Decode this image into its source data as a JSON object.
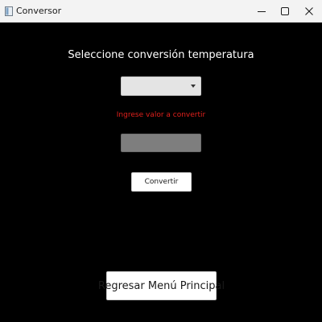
{
  "window": {
    "title": "Conversor",
    "app_icon": "window-app-icon",
    "controls": {
      "minimize_icon": "minimize-icon",
      "maximize_icon": "maximize-icon",
      "close_icon": "close-icon"
    }
  },
  "form": {
    "heading": "Seleccione conversión temperatura",
    "conversion_select": {
      "value": "",
      "icon": "dropdown-arrow-icon"
    },
    "prompt": "Ingrese valor a convertir",
    "value_input": {
      "value": "",
      "placeholder": ""
    },
    "convert_label": "Convertir"
  },
  "footer": {
    "back_label": "Regresar Menú Principal"
  },
  "colors": {
    "background": "#000000",
    "titlebar": "#f3f3f3",
    "prompt_text": "#e0201c",
    "input_disabled": "#7e7e7e"
  }
}
